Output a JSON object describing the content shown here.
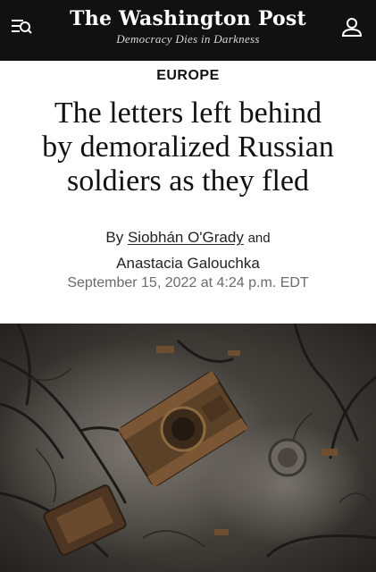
{
  "header": {
    "brand": "The Washington Post",
    "tagline": "Democracy Dies in Darkness",
    "icons": {
      "menu": "menu-search-icon",
      "account": "account-icon"
    }
  },
  "article": {
    "section": "EUROPE",
    "headline_lines": [
      "The letters left behind",
      "by demoralized Russian",
      "soldiers as they fled"
    ],
    "byline": {
      "prefix": "By",
      "author1": "Siobhán O'Grady",
      "conjunction": "and",
      "author2": "Anastacia Galouchka"
    },
    "date": "September 15, 2022 at 4:24 p.m. EDT"
  },
  "colors": {
    "header_bg": "#111111",
    "text": "#111111",
    "muted": "#6b6b6b"
  }
}
